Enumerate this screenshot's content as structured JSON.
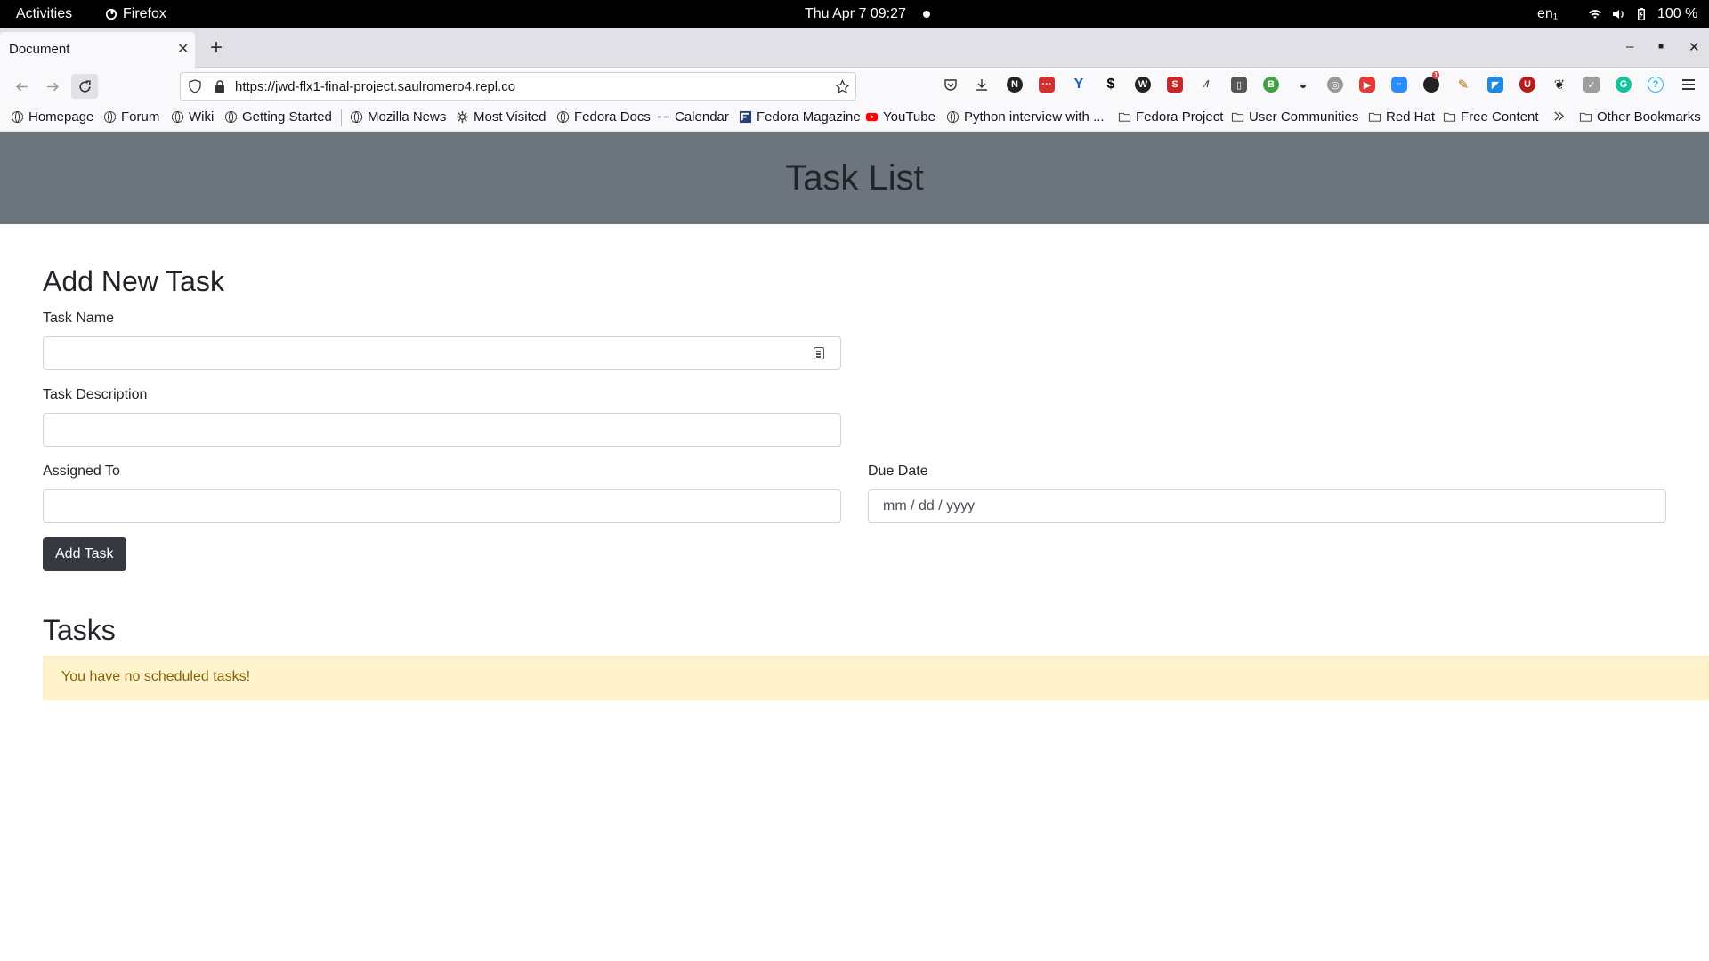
{
  "topbar": {
    "activities": "Activities",
    "app_name": "Firefox",
    "clock": "Thu Apr 7  09:27",
    "lang": "en₁",
    "battery": "100 %"
  },
  "browser": {
    "tab_title": "Document",
    "url": "https://jwd-flx1-final-project.saulromero4.repl.co",
    "extensions_badge": "1",
    "bookmarks": [
      "Homepage",
      "Forum",
      "Wiki",
      "Getting Started",
      "Mozilla News",
      "Most Visited",
      "Fedora Docs",
      "Calendar",
      "Fedora Magazine",
      "YouTube",
      "Python interview with ...",
      "Fedora Project",
      "User Communities",
      "Red Hat",
      "Free Content",
      "Other Bookmarks"
    ]
  },
  "page": {
    "title": "Task List",
    "form": {
      "heading": "Add New Task",
      "task_name_label": "Task Name",
      "task_name_value": "",
      "task_description_label": "Task Description",
      "task_description_value": "",
      "assigned_to_label": "Assigned To",
      "assigned_to_value": "",
      "due_date_label": "Due Date",
      "due_date_placeholder": "mm / dd / yyyy",
      "submit_label": "Add Task"
    },
    "tasks": {
      "heading": "Tasks",
      "empty_message": "You have no scheduled tasks!"
    }
  },
  "colors": {
    "header_bg": "#6c757d",
    "button_bg": "#343a40",
    "alert_bg": "#fff3cd",
    "alert_text": "#856404"
  }
}
